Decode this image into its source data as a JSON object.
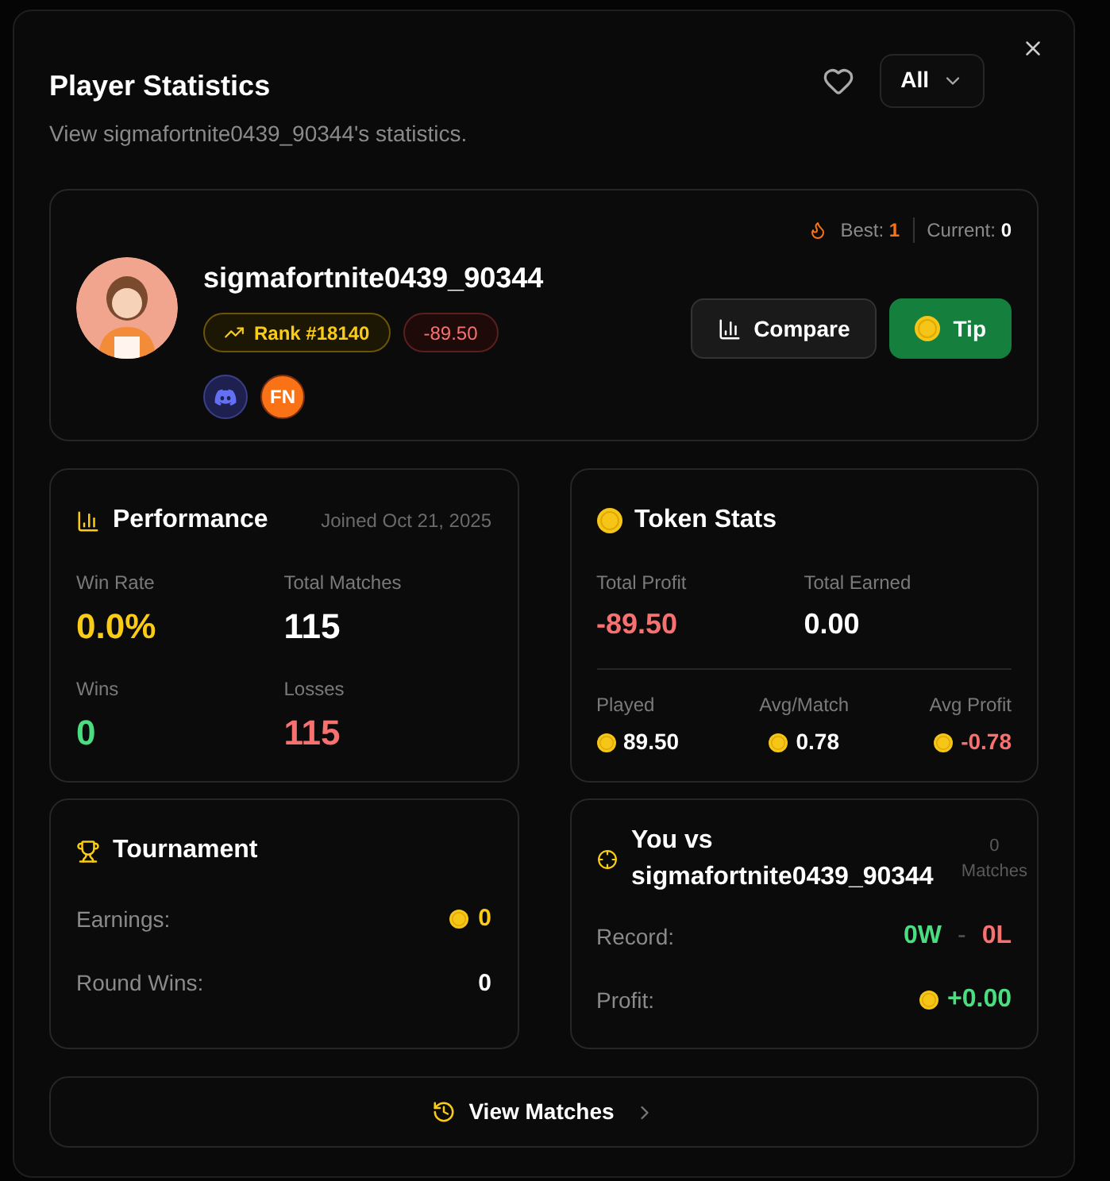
{
  "dialog": {
    "title": "Player Statistics",
    "subtitle": "View sigmafortnite0439_90344's statistics.",
    "filter": "All",
    "profile": {
      "username": "sigmafortnite0439_90344",
      "rank": "Rank #18140",
      "delta": "-89.50",
      "streak": {
        "best_label": "Best:",
        "best": "1",
        "current_label": "Current:",
        "current": "0"
      },
      "socials": [
        {
          "kind": "discord"
        },
        {
          "kind": "fn",
          "label": "FN"
        }
      ],
      "buttons": [
        {
          "kind": "compare",
          "label": "Compare"
        },
        {
          "kind": "tip",
          "label": "Tip"
        }
      ]
    },
    "performance": {
      "title": "Performance",
      "joined": "Joined Oct 21, 2025",
      "stats": [
        {
          "label": "Win Rate",
          "value": "0.0%",
          "color": "#facc15"
        },
        {
          "label": "Total Matches",
          "value": "115",
          "color": "#ffffff"
        },
        {
          "label": "Wins",
          "value": "0",
          "color": "#4ade80"
        },
        {
          "label": "Losses",
          "value": "115",
          "color": "#f87171"
        }
      ]
    },
    "token_stats": {
      "title": "Token Stats",
      "totals": [
        {
          "label": "Total Profit",
          "value": "-89.50",
          "color": "#f87171"
        },
        {
          "label": "Total Earned",
          "value": "0.00",
          "color": "#ffffff"
        }
      ],
      "details": [
        {
          "label": "Played",
          "value": "89.50",
          "color": "#ffffff"
        },
        {
          "label": "Avg/Match",
          "value": "0.78",
          "color": "#ffffff"
        },
        {
          "label": "Avg Profit",
          "value": "-0.78",
          "color": "#f87171"
        }
      ]
    },
    "tournament": {
      "title": "Tournament",
      "rows": [
        {
          "label": "Earnings:",
          "value": "0",
          "coin": true,
          "color": "#facc15"
        },
        {
          "label": "Round Wins:",
          "value": "0",
          "coin": false,
          "color": "#ffffff"
        }
      ]
    },
    "versus": {
      "title_lines": [
        "You vs",
        "sigmafortnite0439_90344"
      ],
      "matches_count": "0",
      "matches_label": "Matches",
      "record_label": "Record:",
      "wins": "0W",
      "separator": "-",
      "losses": "0L",
      "profit_label": "Profit:",
      "profit": "+0.00"
    },
    "view_matches": "View Matches"
  }
}
